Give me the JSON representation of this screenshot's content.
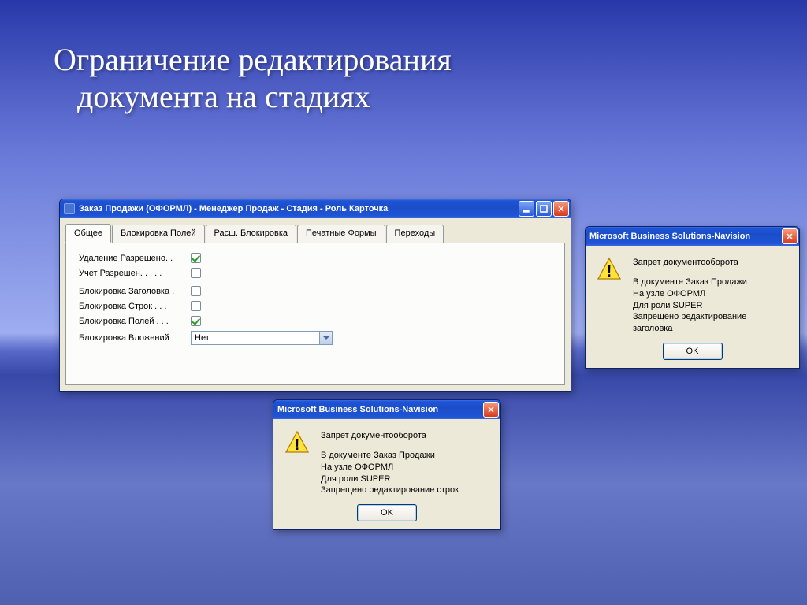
{
  "slide": {
    "title": "Ограничение редактирования\n   документа на стадиях"
  },
  "main_window": {
    "title": "Заказ Продажи (ОФОРМЛ) - Менеджер Продаж - Стадия - Роль Карточка",
    "tabs": [
      "Общее",
      "Блокировка Полей",
      "Расш. Блокировка",
      "Печатные Формы",
      "Переходы"
    ],
    "fields": {
      "delete_allowed": {
        "label": "Удаление Разрешено. .",
        "checked": true
      },
      "post_allowed": {
        "label": "Учет Разрешен.  .  .  .  .",
        "checked": false
      },
      "block_header": {
        "label": "Блокировка Заголовка .",
        "checked": false
      },
      "block_lines": {
        "label": "Блокировка Строк  .  .  .",
        "checked": false
      },
      "block_fields": {
        "label": "Блокировка Полей  .  .  .",
        "checked": true
      },
      "block_attach": {
        "label": "Блокировка Вложений .",
        "value": "Нет"
      }
    }
  },
  "dialog1": {
    "title": "Microsoft Business Solutions-Navision",
    "heading": "Запрет документооборота",
    "lines": [
      "В документе Заказ Продажи",
      "На узле ОФОРМЛ",
      "Для роли SUPER",
      "Запрещено редактирование заголовка"
    ],
    "ok": "OK"
  },
  "dialog2": {
    "title": "Microsoft Business Solutions-Navision",
    "heading": "Запрет документооборота",
    "lines": [
      "В документе Заказ Продажи",
      "На узле ОФОРМЛ",
      "Для роли SUPER",
      "Запрещено редактирование строк"
    ],
    "ok": "OK"
  }
}
